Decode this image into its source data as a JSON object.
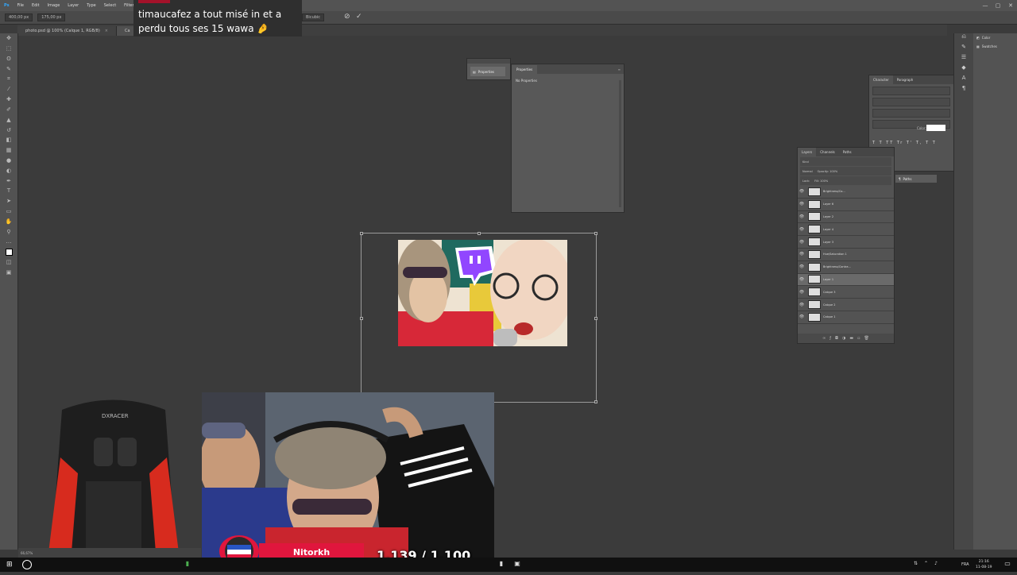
{
  "app": {
    "menu": [
      "File",
      "Edit",
      "Image",
      "Layer",
      "Type",
      "Select",
      "Filter"
    ],
    "window_controls": [
      "—",
      "▢",
      "✕"
    ]
  },
  "options_bar": {
    "width_field": "400,00 px",
    "height_field": "175,00 px",
    "interpolation": "Bicubic",
    "cancel_icon": "cancel-icon",
    "commit_icon": "checkmark-icon"
  },
  "tabs": [
    {
      "label": "photo.psd @ 100% (Calque 1, RGB/8)",
      "active": false
    },
    {
      "label": "Ca",
      "active": true
    }
  ],
  "properties_panel": {
    "collapsed_label": "Properties",
    "title": "Properties",
    "body": "No Properties"
  },
  "character_panel": {
    "tabs": [
      "Character",
      "Paragraph"
    ],
    "color_label": "Color:",
    "color_value": "#ffffff",
    "style_glyphs": "T T TT Tr T' T, T T"
  },
  "paths_item": "Paths",
  "layers_panel": {
    "tabs": [
      "Layers",
      "Channels",
      "Paths"
    ],
    "filter_label": "Kind",
    "blend_mode": "Normal",
    "opacity_label": "Opacity: 100%",
    "lock_label": "Lock:",
    "fill_label": "Fill: 100%",
    "layers": [
      {
        "name": "Brightness/Co...",
        "selected": false
      },
      {
        "name": "Layer 6",
        "selected": false
      },
      {
        "name": "Layer 2",
        "selected": false
      },
      {
        "name": "Layer 4",
        "selected": false
      },
      {
        "name": "Layer 3",
        "selected": false
      },
      {
        "name": "Hue/Saturation 1",
        "selected": false
      },
      {
        "name": "Brightness/Contra...",
        "selected": false
      },
      {
        "name": "Layer 1",
        "selected": true
      },
      {
        "name": "Calque 3",
        "selected": false
      },
      {
        "name": "Calque 2",
        "selected": false
      },
      {
        "name": "Calque 1",
        "selected": false
      }
    ]
  },
  "right_dock": {
    "items": [
      "Color",
      "Swatches"
    ]
  },
  "chat": {
    "message": "timaucafez a tout misé in et a perdu tous ses 15 wawa 🤌"
  },
  "stream": {
    "streamer_name": "Nitorkh",
    "counter": "1,139 / 1,100"
  },
  "status": {
    "zoom": "66,67%"
  },
  "taskbar": {
    "lang": "FRA",
    "time": "21:16",
    "date": "11-08-19"
  }
}
